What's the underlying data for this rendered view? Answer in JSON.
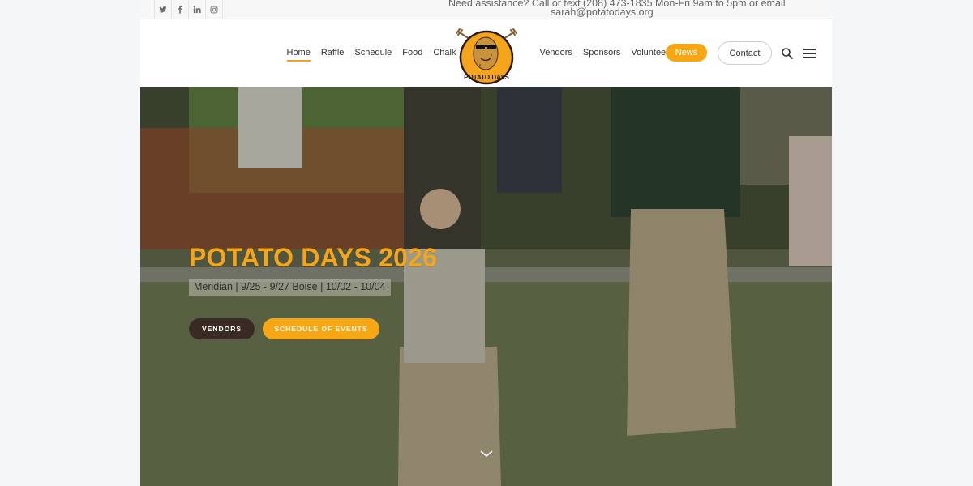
{
  "topbar": {
    "social": [
      {
        "name": "twitter-icon"
      },
      {
        "name": "facebook-icon"
      },
      {
        "name": "linkedin-icon"
      },
      {
        "name": "instagram-icon"
      }
    ],
    "assist_line1": "Need assistance? Call or text (208) 473-1835 Mon-Fri 9am to 5pm or email",
    "assist_line2": "sarah@potatodays.org"
  },
  "nav": {
    "left": [
      "Home",
      "Raffle",
      "Schedule",
      "Food",
      "Chalk"
    ],
    "right": [
      "Vendors",
      "Sponsors",
      "Volunteer"
    ],
    "active": "Home",
    "news_label": "News",
    "contact_label": "Contact"
  },
  "logo": {
    "text": "POTATO DAYS"
  },
  "hero": {
    "title": "POTATO DAYS 2026",
    "subtitle": "Meridian | 9/25 - 9/27 Boise | 10/02 - 10/04",
    "vendors_label": "VENDORS",
    "schedule_label": "SCHEDULE OF EVENTS"
  },
  "colors": {
    "accent": "#f7a614",
    "dark_button": "#3a2a24"
  }
}
